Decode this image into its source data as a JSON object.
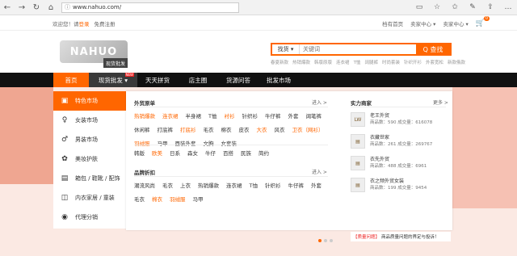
{
  "browser": {
    "url": "www.nahuo.com/"
  },
  "topbar": {
    "welcome": "欢迎您！请",
    "login": "登录",
    "register": "免费注册",
    "links": [
      "档有首页",
      "卖家中心 ▾",
      "卖家中心 ▾"
    ],
    "cart_count": "0"
  },
  "logo": {
    "button": "现货批发"
  },
  "search": {
    "category": "找货 ▾",
    "placeholder": "关键词",
    "button": "Q 查找",
    "hotwords": [
      "春夏新款",
      "热销爆款",
      "韩版原版",
      "连衣裙",
      "T恤",
      "阔腿裤",
      "时尚套装",
      "针织开衫",
      "外套宽松",
      "新款俄款"
    ]
  },
  "nav": {
    "items": [
      "首页",
      "现货批发",
      "天天拼货",
      "店主圈",
      "货源问答",
      "批发市场"
    ],
    "new_badge": "NEW"
  },
  "sidebar": {
    "categories": [
      {
        "label": "特色市场",
        "icon": "tag-icon"
      },
      {
        "label": "女装市场",
        "icon": "dress-icon"
      },
      {
        "label": "男装市场",
        "icon": "shirt-icon"
      },
      {
        "label": "美妆护肤",
        "icon": "lipstick-icon"
      },
      {
        "label": "箱包 / 鞋靴 / 配饰",
        "icon": "bag-icon"
      },
      {
        "label": "内衣家居 / 童装",
        "icon": "kids-shirt-icon"
      },
      {
        "label": "代理分销",
        "icon": "agent-icon"
      }
    ]
  },
  "panel": {
    "foreign": {
      "title": "外贸原单",
      "more": "进入 >",
      "tags_row1": [
        "热销爆款",
        "连衣裙",
        "半身裙",
        "T恤",
        "衬衫",
        "针织衫",
        "牛仔裤",
        "外套"
      ],
      "tags_row2": [
        "阔笔裤",
        "休闲裤",
        "打底裤",
        "打底衫",
        "毛衣",
        "棉衣",
        "皮衣",
        "大衣",
        "风衣"
      ],
      "tags_row3": [
        "卫衣（网衫）",
        "羽绒服",
        "马甲",
        "西装外套",
        "文胸",
        "女套装"
      ],
      "tags_row4": [
        "韩版",
        "欧美",
        "日系",
        "森女",
        "牛仔",
        "百搭",
        "民族",
        "简约"
      ]
    },
    "brand": {
      "title": "品牌折扣",
      "more": "进入 >",
      "tags_row1": [
        "潮流风尚",
        "毛衣",
        "上衣",
        "热销爆款",
        "连衣裙",
        "T恤",
        "针织衫",
        "牛仔裤"
      ],
      "tags_row2": [
        "外套",
        "毛衣",
        "棉衣",
        "羽绒服",
        "马甲"
      ]
    },
    "merchants": {
      "title": "实力商家",
      "more": "更多 >",
      "list": [
        {
          "name": "老王外贸",
          "logo": "LW",
          "stats": "商品数：590  成交量：616078"
        },
        {
          "name": "衣藏世家",
          "logo": "",
          "stats": "商品数：261  成交量：269767"
        },
        {
          "name": "衣先外贸",
          "logo": "",
          "stats": "商品数：488  成交量：6961"
        },
        {
          "name": "衣之频外贸女装",
          "logo": "",
          "stats": "商品数：199  成交量：9454"
        }
      ]
    }
  },
  "notice": {
    "tag": "【质量问题】",
    "text": "商品质量问题的界定与投诉！"
  },
  "colors": {
    "accent": "#ff6600",
    "nav_bg": "#111111"
  }
}
